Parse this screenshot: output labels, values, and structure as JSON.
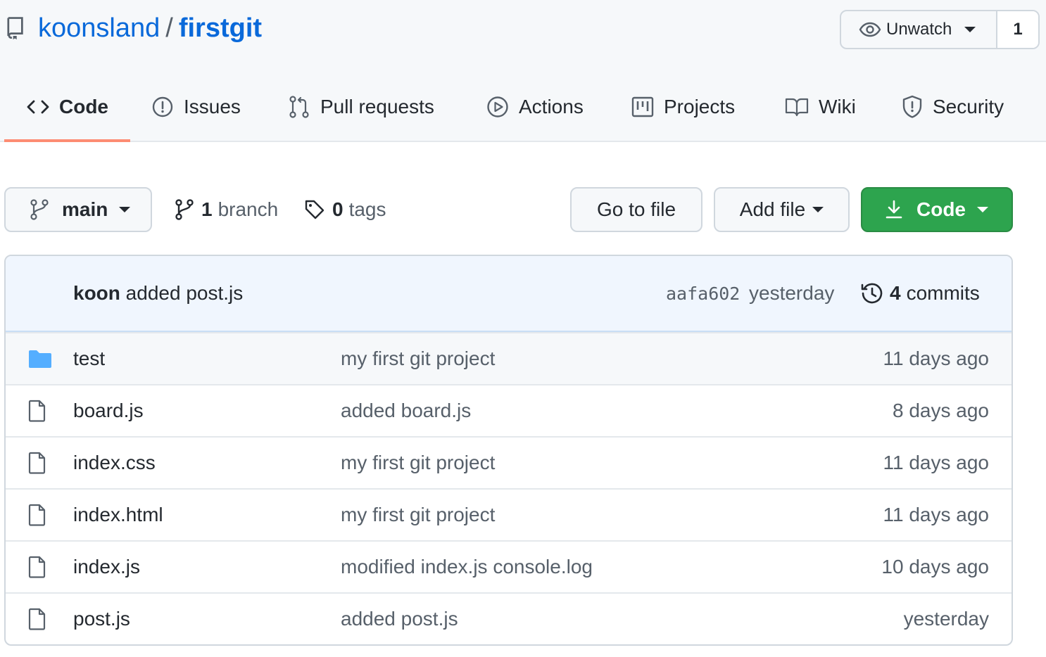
{
  "repo": {
    "owner": "koonsland",
    "separator": "/",
    "name": "firstgit"
  },
  "watch": {
    "label": "Unwatch",
    "count": "1"
  },
  "tabs": [
    {
      "label": "Code",
      "icon": "code-icon",
      "active": true
    },
    {
      "label": "Issues",
      "icon": "issue-icon"
    },
    {
      "label": "Pull requests",
      "icon": "pull-request-icon"
    },
    {
      "label": "Actions",
      "icon": "play-icon"
    },
    {
      "label": "Projects",
      "icon": "project-icon"
    },
    {
      "label": "Wiki",
      "icon": "book-icon"
    },
    {
      "label": "Security",
      "icon": "shield-icon"
    }
  ],
  "toolbar": {
    "branch": "main",
    "branch_count": "1",
    "branch_word": "branch",
    "tag_count": "0",
    "tag_word": "tags",
    "go_to_file": "Go to file",
    "add_file": "Add file",
    "code": "Code"
  },
  "latest_commit": {
    "author": "koon",
    "message": "added post.js",
    "sha": "aafa602",
    "time": "yesterday",
    "commit_count": "4",
    "commit_word": "commits"
  },
  "files": [
    {
      "type": "folder",
      "name": "test",
      "message": "my first git project",
      "age": "11 days ago"
    },
    {
      "type": "file",
      "name": "board.js",
      "message": "added board.js",
      "age": "8 days ago"
    },
    {
      "type": "file",
      "name": "index.css",
      "message": "my first git project",
      "age": "11 days ago"
    },
    {
      "type": "file",
      "name": "index.html",
      "message": "my first git project",
      "age": "11 days ago"
    },
    {
      "type": "file",
      "name": "index.js",
      "message": "modified index.js console.log",
      "age": "10 days ago"
    },
    {
      "type": "file",
      "name": "post.js",
      "message": "added post.js",
      "age": "yesterday"
    }
  ],
  "colors": {
    "link": "#0969da",
    "tab_underline": "#fd8c73",
    "code_button": "#2da44e",
    "folder": "#54aeff"
  }
}
